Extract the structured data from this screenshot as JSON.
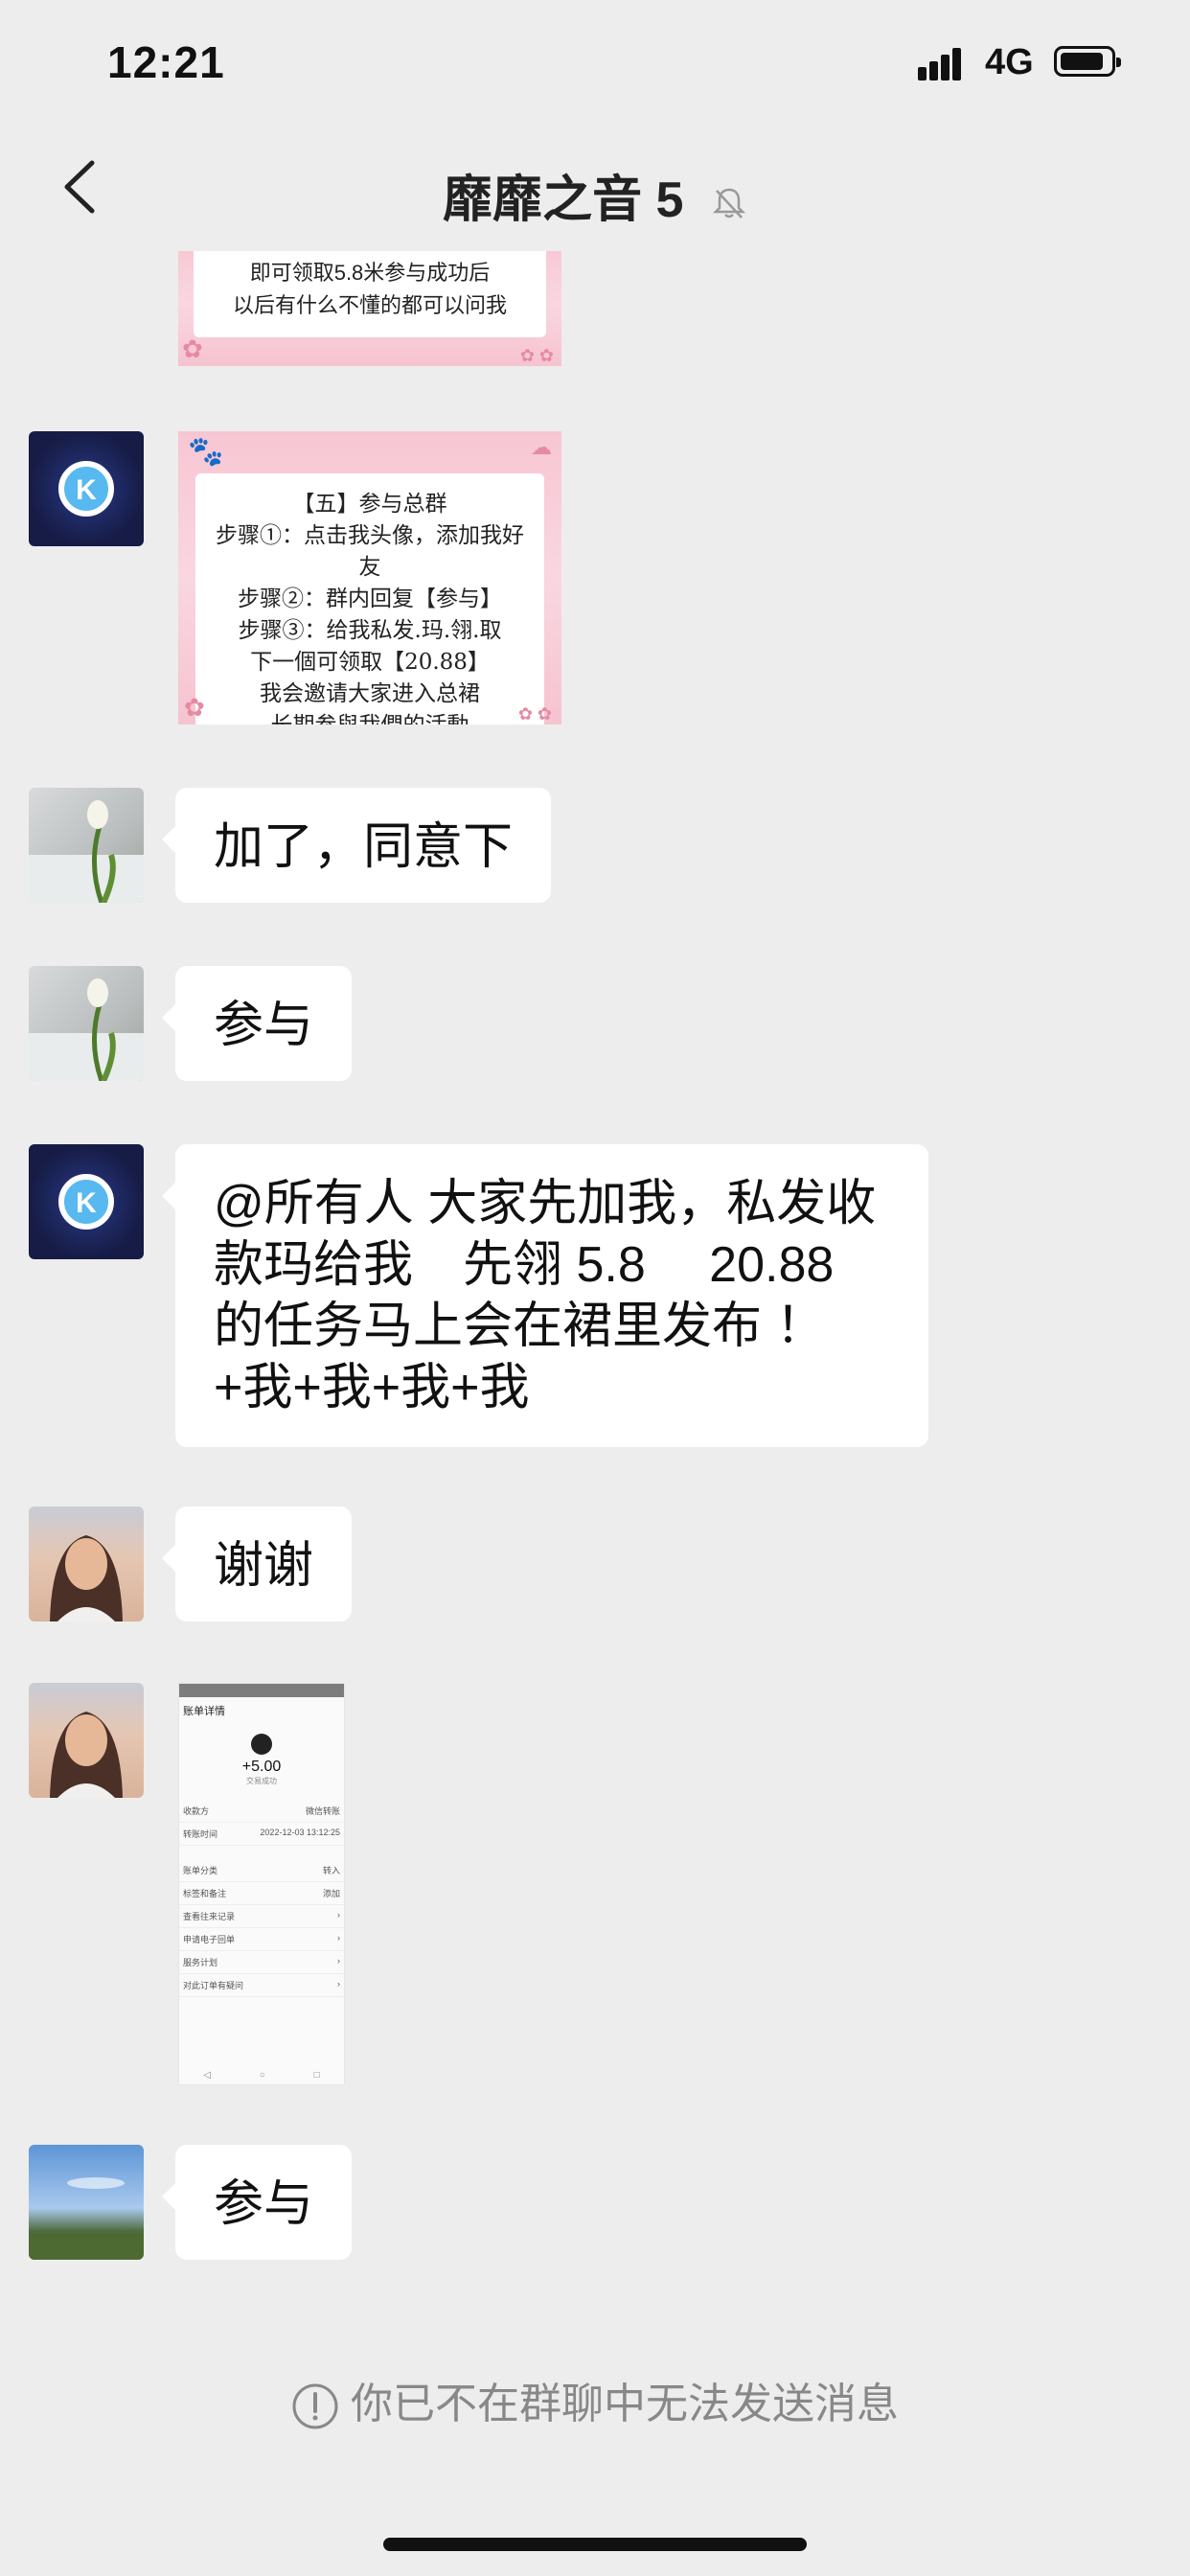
{
  "status_bar": {
    "time": "12:21",
    "network": "4G"
  },
  "nav": {
    "title": "靡靡之音 5"
  },
  "messages": {
    "m1_card": {
      "lines": [
        "即可领取5.8米参与成功后",
        "以后有什么不懂的都可以问我"
      ]
    },
    "m2_card": {
      "lines": [
        "【五】参与总群",
        "步骤①：点击我头像，添加我好友",
        "步骤②：群内回复【参与】",
        "步骤③：给我私发.玛.翎.取",
        "下一個可领取【20.88】",
        "我会邀请大家进入总裙",
        "长期参與我們的活動"
      ]
    },
    "m3_text": "加了，同意下",
    "m4_text": "参与",
    "m5_text": "@所有人 大家先加我，私发收款玛给我　先翎 5.8　 20.88的任务马上会在裙里发布 ！+我+我+我+我",
    "m6_text": "谢谢",
    "m7_receipt": {
      "title": "账单详情",
      "amount": "+5.00",
      "status": "交易成功",
      "rows": [
        [
          "收款方",
          "微信转账"
        ],
        [
          "转账时间",
          "2022-12-03 13:12:25"
        ],
        [
          "账单分类",
          "转入"
        ],
        [
          "标签和备注",
          "添加"
        ],
        [
          "查看往来记录",
          ""
        ],
        [
          "申请电子回单",
          ""
        ],
        [
          "服务计划",
          ""
        ],
        [
          "对此订单有疑问",
          ""
        ]
      ]
    },
    "m8_text": "参与"
  },
  "footer": {
    "note": "你已不在群聊中无法发送消息"
  },
  "colors": {
    "background": "#ededed",
    "bubble": "#ffffff",
    "card_pink": "#f7c6d3",
    "muted_text": "#888888"
  }
}
